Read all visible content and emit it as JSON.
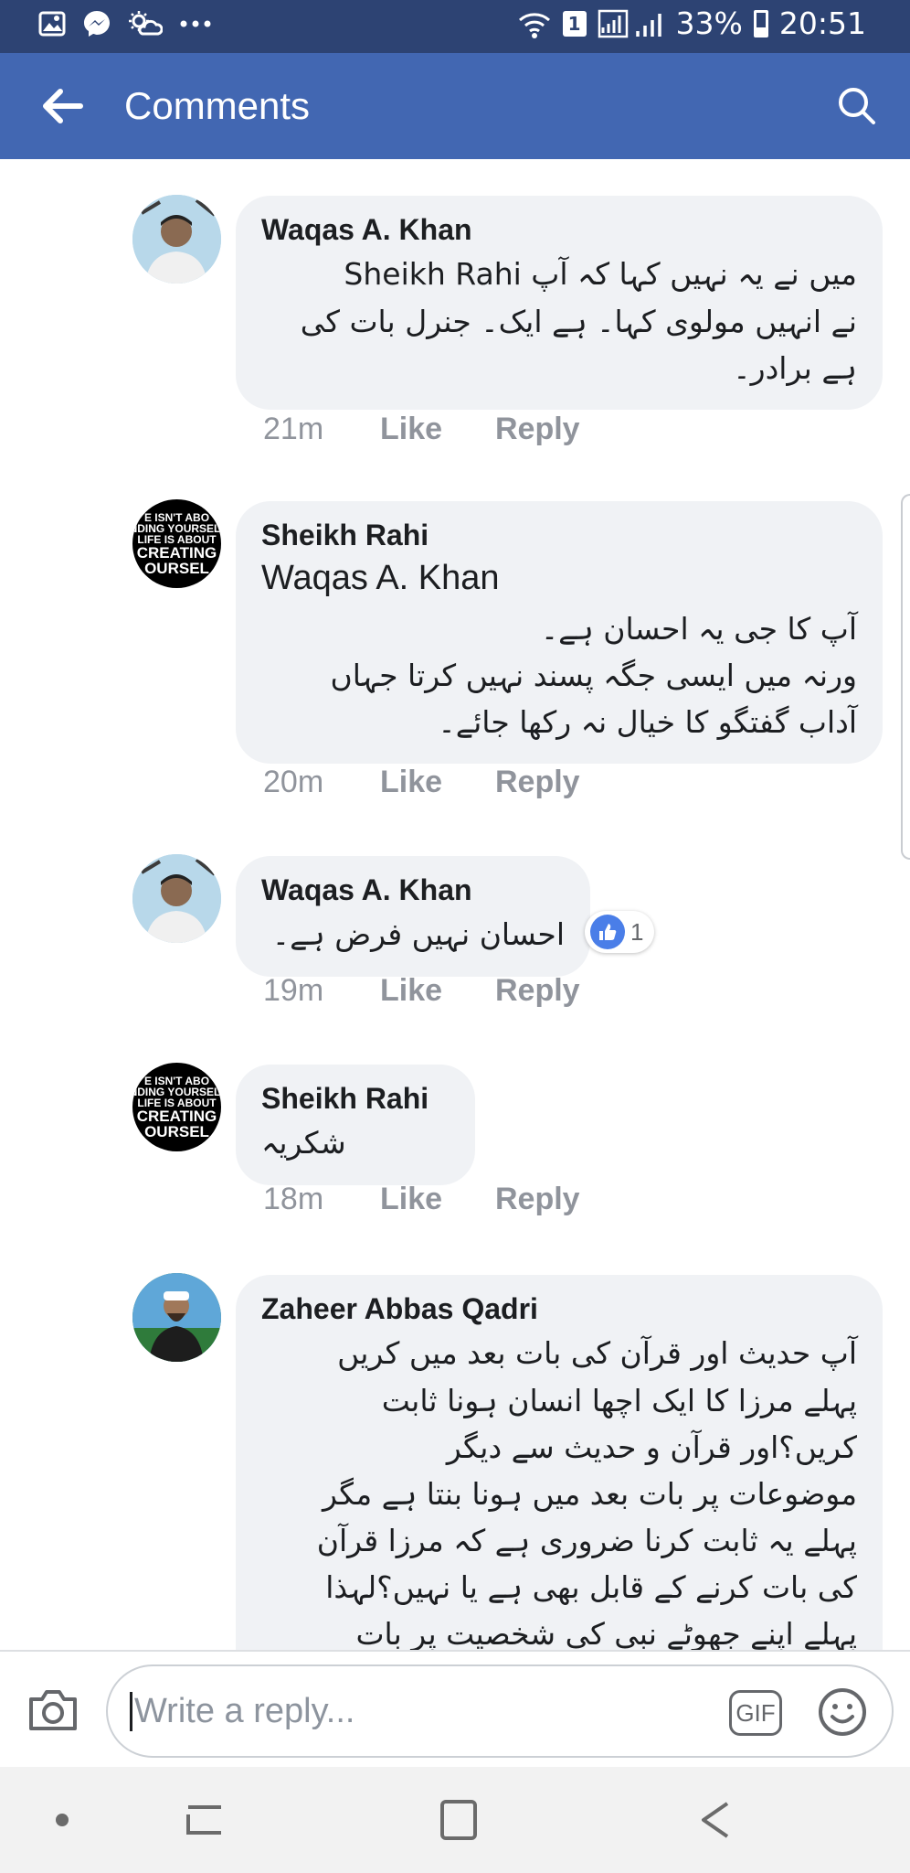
{
  "status_bar": {
    "sim_badge": "1",
    "battery": "33%",
    "time": "20:51",
    "icons": [
      "gallery-icon",
      "messenger-icon",
      "weather-icon",
      "more-dots-icon",
      "wifi-icon",
      "signal-icon",
      "battery-icon"
    ]
  },
  "header": {
    "title": "Comments",
    "back_icon": "arrow-left-icon",
    "search_icon": "search-icon"
  },
  "comments": [
    {
      "author": "Waqas A. Khan",
      "text": "میں نے یہ نہیں کہا کہ آپ Sheikh Rahi\nنے انہیں مولوی کہا۔ ہے ایک۔ جنرل بات کی\nہے برادر۔",
      "time": "21m",
      "like_label": "Like",
      "reply_label": "Reply"
    },
    {
      "author": "Sheikh Rahi",
      "mention": "Waqas A. Khan",
      "text": "آپ کا جی یہ احسان ہے۔\nورنہ میں ایسی جگہ پسند نہیں کرتا جہاں\nآداب گفتگو کا خیال نہ رکھا جائے۔",
      "time": "20m",
      "like_label": "Like",
      "reply_label": "Reply"
    },
    {
      "author": "Waqas A. Khan",
      "text": "احسان نہیں فرض ہے۔",
      "time": "19m",
      "like_label": "Like",
      "reply_label": "Reply",
      "reaction_count": "1"
    },
    {
      "author": "Sheikh Rahi",
      "text": "شکریہ",
      "time": "18m",
      "like_label": "Like",
      "reply_label": "Reply"
    },
    {
      "author": "Zaheer Abbas Qadri",
      "text": "آپ  حدیث اور قرآن کی بات بعد میں کریں\nپہلے مرزا کا ایک اچھا انسان ہونا ثابت\nکریں؟اور قرآن و حدیث سے دیگر\nموضوعات پر بات بعد میں ہونا بنتا ہے مگر\nپہلے یہ ثابت کرنا ضروری ہے کہ مرزا قرآن\nکی بات کرنے کے قابل بھی ہے یا نہیں؟لہذا\nپہلے اپنے جھوٹے نبی کی شخصیت پر بات"
    }
  ],
  "avatar_text": {
    "line1": "E ISN'T ABO",
    "line2": "INDING YOURSELF",
    "line3": "LIFE IS ABOUT",
    "line4": "CREATING",
    "line5": "OURSEL"
  },
  "composer": {
    "placeholder": "Write a reply...",
    "gif_label": "GIF",
    "camera_icon": "camera-icon",
    "emoji_icon": "emoji-icon"
  },
  "nav_bar": {
    "icons": [
      "dot-icon",
      "recent-apps-icon",
      "home-icon",
      "back-icon"
    ]
  },
  "colors": {
    "status_bar": "#2d4373",
    "header": "#4267b2",
    "bubble": "#f0f2f5",
    "meta_text": "#90949c",
    "like_badge": "#4a7ee8"
  }
}
